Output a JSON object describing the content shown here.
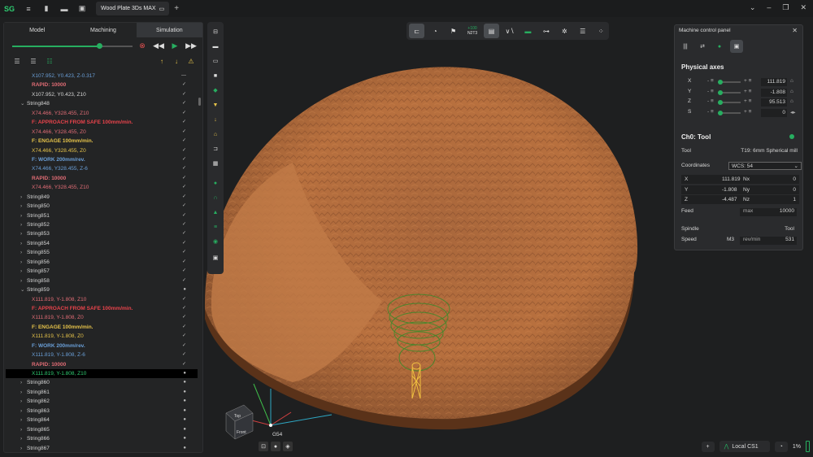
{
  "titlebar": {
    "tab_title": "Wood Plate 3Ds MAX",
    "logo": "app-logo"
  },
  "left_tabs": [
    "Model",
    "Machining",
    "Simulation"
  ],
  "simulation": {
    "progress": 0.72
  },
  "tree": [
    {
      "text": "X107.952, Y0.423, Z-0.317",
      "color": "#6a9fd8",
      "indent": 32,
      "mark": "—"
    },
    {
      "text": "RAPID: 10000",
      "color": "#e06c75",
      "indent": 32,
      "mark": "✓",
      "bold": true
    },
    {
      "text": "X107.952, Y0.423, Z10",
      "color": "#d4d4d4",
      "indent": 32,
      "mark": "✓"
    },
    {
      "text": "String848",
      "color": "#d4d4d4",
      "indent": 26,
      "mark": "✓",
      "arrow": "v"
    },
    {
      "text": "X74.466, Y328.455, Z10",
      "color": "#e06c75",
      "indent": 32,
      "mark": "✓"
    },
    {
      "text": "F: APPROACH FROM SAFE 100mm/min.",
      "color": "#e8434b",
      "indent": 32,
      "mark": "✓",
      "bold": true
    },
    {
      "text": "X74.466, Y328.455, Z0",
      "color": "#e06c75",
      "indent": 32,
      "mark": "✓"
    },
    {
      "text": "F: ENGAGE 100mm/min.",
      "color": "#e6c34a",
      "indent": 32,
      "mark": "✓",
      "bold": true
    },
    {
      "text": "X74.466, Y328.455, Z0",
      "color": "#e6c34a",
      "indent": 32,
      "mark": "✓"
    },
    {
      "text": "F: WORK 200mm/rev.",
      "color": "#6a9fd8",
      "indent": 32,
      "mark": "✓",
      "bold": true
    },
    {
      "text": "X74.466, Y328.455, Z-6",
      "color": "#6a9fd8",
      "indent": 32,
      "mark": "✓"
    },
    {
      "text": "RAPID: 10000",
      "color": "#e06c75",
      "indent": 32,
      "mark": "✓",
      "bold": true
    },
    {
      "text": "X74.466, Y328.455, Z10",
      "color": "#e06c75",
      "indent": 32,
      "mark": "✓"
    },
    {
      "text": "String849",
      "color": "#d4d4d4",
      "indent": 26,
      "mark": "✓",
      "arrow": ">"
    },
    {
      "text": "String850",
      "color": "#d4d4d4",
      "indent": 26,
      "mark": "✓",
      "arrow": ">"
    },
    {
      "text": "String851",
      "color": "#d4d4d4",
      "indent": 26,
      "mark": "✓",
      "arrow": ">"
    },
    {
      "text": "String852",
      "color": "#d4d4d4",
      "indent": 26,
      "mark": "✓",
      "arrow": ">"
    },
    {
      "text": "String853",
      "color": "#d4d4d4",
      "indent": 26,
      "mark": "✓",
      "arrow": ">"
    },
    {
      "text": "String854",
      "color": "#d4d4d4",
      "indent": 26,
      "mark": "✓",
      "arrow": ">"
    },
    {
      "text": "String855",
      "color": "#d4d4d4",
      "indent": 26,
      "mark": "✓",
      "arrow": ">"
    },
    {
      "text": "String856",
      "color": "#d4d4d4",
      "indent": 26,
      "mark": "✓",
      "arrow": ">"
    },
    {
      "text": "String857",
      "color": "#d4d4d4",
      "indent": 26,
      "mark": "✓",
      "arrow": ">"
    },
    {
      "text": "String858",
      "color": "#d4d4d4",
      "indent": 26,
      "mark": "✓",
      "arrow": ">"
    },
    {
      "text": "String859",
      "color": "#d4d4d4",
      "indent": 26,
      "mark": "●",
      "arrow": "v"
    },
    {
      "text": "X111.819, Y-1.808, Z10",
      "color": "#e06c75",
      "indent": 32,
      "mark": "✓"
    },
    {
      "text": "F: APPROACH FROM SAFE 100mm/min.",
      "color": "#e8434b",
      "indent": 32,
      "mark": "✓",
      "bold": true
    },
    {
      "text": "X111.819, Y-1.808, Z0",
      "color": "#e06c75",
      "indent": 32,
      "mark": "✓"
    },
    {
      "text": "F: ENGAGE 100mm/min.",
      "color": "#e6c34a",
      "indent": 32,
      "mark": "✓",
      "bold": true
    },
    {
      "text": "X111.819, Y-1.808, Z0",
      "color": "#e6c34a",
      "indent": 32,
      "mark": "✓"
    },
    {
      "text": "F: WORK 200mm/rev.",
      "color": "#6a9fd8",
      "indent": 32,
      "mark": "✓",
      "bold": true
    },
    {
      "text": "X111.819, Y-1.808, Z-6",
      "color": "#6a9fd8",
      "indent": 32,
      "mark": "✓"
    },
    {
      "text": "RAPID: 10000",
      "color": "#e06c75",
      "indent": 32,
      "mark": "✓",
      "bold": true
    },
    {
      "text": "X111.819, Y-1.808, Z10",
      "color": "#2ecc71",
      "indent": 32,
      "mark": "●",
      "selected": true
    },
    {
      "text": "String860",
      "color": "#d4d4d4",
      "indent": 26,
      "mark": "●",
      "arrow": ">"
    },
    {
      "text": "String861",
      "color": "#d4d4d4",
      "indent": 26,
      "mark": "●",
      "arrow": ">"
    },
    {
      "text": "String862",
      "color": "#d4d4d4",
      "indent": 26,
      "mark": "●",
      "arrow": ">"
    },
    {
      "text": "String863",
      "color": "#d4d4d4",
      "indent": 26,
      "mark": "●",
      "arrow": ">"
    },
    {
      "text": "String864",
      "color": "#d4d4d4",
      "indent": 26,
      "mark": "●",
      "arrow": ">"
    },
    {
      "text": "String865",
      "color": "#d4d4d4",
      "indent": 26,
      "mark": "●",
      "arrow": ">"
    },
    {
      "text": "String866",
      "color": "#d4d4d4",
      "indent": 26,
      "mark": "●",
      "arrow": ">"
    },
    {
      "text": "String867",
      "color": "#d4d4d4",
      "indent": 26,
      "mark": "●",
      "arrow": ">"
    }
  ],
  "machine_panel": {
    "title": "Machine control panel",
    "physical_axes_heading": "Physical axes",
    "axes": [
      {
        "name": "X",
        "value": "111.819"
      },
      {
        "name": "Y",
        "value": "-1.808"
      },
      {
        "name": "Z",
        "value": "95.513"
      },
      {
        "name": "S",
        "value": "0"
      }
    ],
    "ch0_heading": "Ch0: Tool",
    "tool_label": "Tool",
    "tool_value": "T19: 6mm Spherical mill",
    "coordinates_label": "Coordinates",
    "wcs_value": "WCS: 54",
    "coords": [
      {
        "k": "X",
        "v": "111.819",
        "nk": "Nx",
        "nv": "0"
      },
      {
        "k": "Y",
        "v": "-1.808",
        "nk": "Ny",
        "nv": "0"
      },
      {
        "k": "Z",
        "v": "-4.487",
        "nk": "Nz",
        "nv": "1"
      }
    ],
    "feed_label": "Feed",
    "feed_unit": "max",
    "feed_value": "10000",
    "spindle_label": "Spindle",
    "spindle_tool_label": "Tool",
    "speed_label": "Speed",
    "speed_mode": "M3",
    "speed_unit": "rev/min",
    "speed_value": "531"
  },
  "toptool": {
    "counter_top": "+100",
    "counter_bottom": "N2T3"
  },
  "gizmo": {
    "label": "G54",
    "top_face": "Top",
    "front_face": "Front"
  },
  "status": {
    "cs_label": "Local CS1",
    "percent": "1%"
  },
  "colors": {
    "accent": "#27ae60",
    "surface": "#b86d3c",
    "background": "#1e1f20"
  }
}
